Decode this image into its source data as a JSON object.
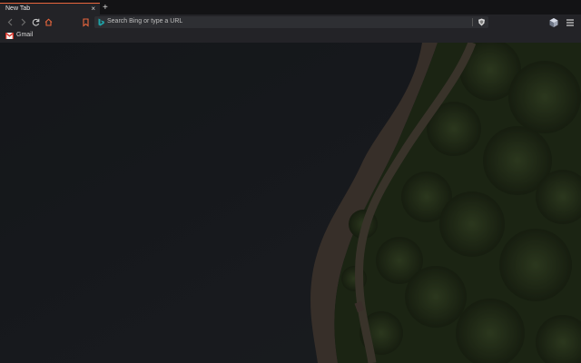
{
  "tab": {
    "title": "New Tab",
    "close_glyph": "×"
  },
  "tabstrip": {
    "new_tab_glyph": "+"
  },
  "toolbar": {
    "icons": [
      "back-icon",
      "forward-icon",
      "reload-icon",
      "home-icon",
      "bookmark-icon"
    ]
  },
  "omnibox": {
    "placeholder": "Search Bing or type a URL",
    "search_engine_icon": "bing-icon"
  },
  "extensions": [
    "brave-shield-icon",
    "brave-rewards-icon",
    "app-menu-icon"
  ],
  "bookmarks": [
    {
      "label": "Gmail",
      "icon": "gmail-icon"
    }
  ],
  "colors": {
    "accent": "#e8663d",
    "tabstrip": "#131315",
    "toolbar": "#232327",
    "omnibox": "#2e2f33",
    "lake": "#1d2025",
    "forest": "#2e3a22",
    "trail": "#4c433a",
    "shore": "#5a4c42"
  },
  "background": {
    "description_icon": "aerial-lake-forest-wallpaper"
  }
}
